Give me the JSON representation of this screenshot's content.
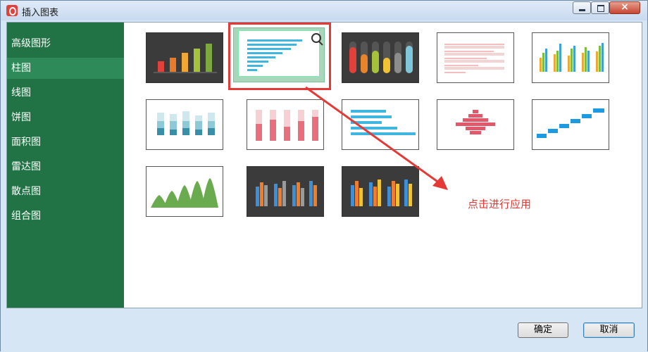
{
  "window": {
    "title": "插入图表"
  },
  "sidebar": {
    "items": [
      {
        "label": "高级图形"
      },
      {
        "label": "柱图"
      },
      {
        "label": "线图"
      },
      {
        "label": "饼图"
      },
      {
        "label": "面积图"
      },
      {
        "label": "雷达图"
      },
      {
        "label": "散点图"
      },
      {
        "label": "组合图"
      }
    ],
    "active_index": 1
  },
  "annotation": {
    "text": "点击进行应用"
  },
  "buttons": {
    "ok": "确定",
    "cancel": "取消"
  },
  "colors": {
    "accent": "#217346",
    "highlight": "#e53935"
  }
}
